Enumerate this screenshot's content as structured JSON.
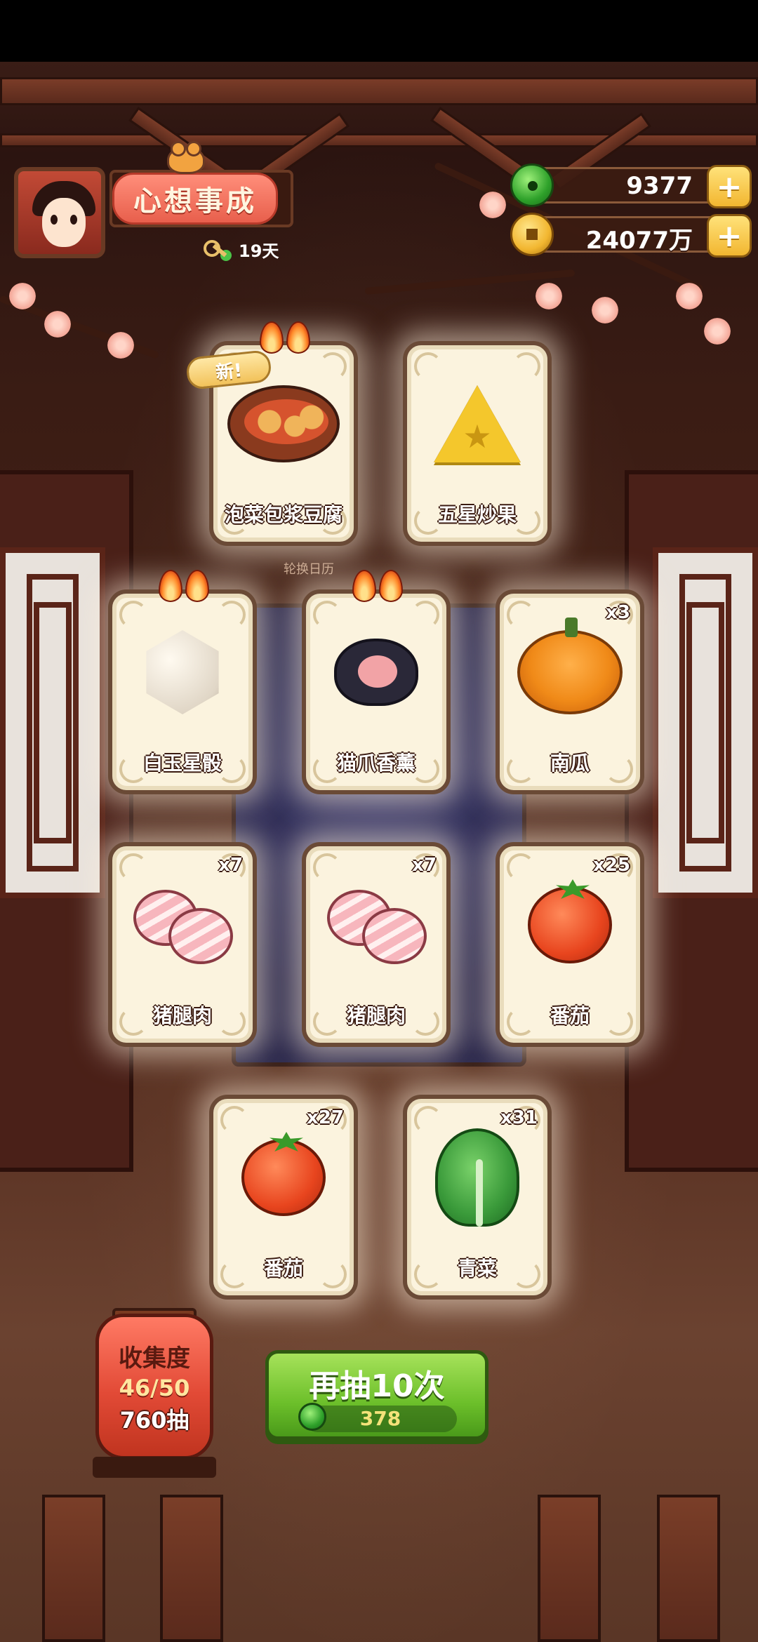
{
  "header": {
    "title_banner": "心想事成",
    "days_label": "19天"
  },
  "currencies": {
    "jade": {
      "value": "9377",
      "icon": "jade-icon"
    },
    "coins": {
      "value": "24077万",
      "icon": "coin-icon"
    },
    "plus_glyph": "+"
  },
  "new_badge": "新!",
  "calendar_caption": "轮换日历",
  "cards": [
    {
      "name": "泡菜包浆豆腐",
      "qty": "",
      "icon": "tofu-dish-icon",
      "flames": 2,
      "new": true
    },
    {
      "name": "五星炒果",
      "qty": "",
      "icon": "star-fruit-icon",
      "flames": 0,
      "new": false
    },
    {
      "name": "白玉星骰",
      "qty": "",
      "icon": "jade-dice-icon",
      "flames": 2,
      "new": false
    },
    {
      "name": "猫爪香薰",
      "qty": "",
      "icon": "cat-paw-candle-icon",
      "flames": 2,
      "new": false
    },
    {
      "name": "南瓜",
      "qty": "x3",
      "icon": "pumpkin-icon",
      "flames": 0,
      "new": false
    },
    {
      "name": "猪腿肉",
      "qty": "x7",
      "icon": "pork-leg-icon",
      "flames": 0,
      "new": false
    },
    {
      "name": "猪腿肉",
      "qty": "x7",
      "icon": "pork-leg-icon",
      "flames": 0,
      "new": false
    },
    {
      "name": "番茄",
      "qty": "x25",
      "icon": "tomato-icon",
      "flames": 0,
      "new": false
    },
    {
      "name": "番茄",
      "qty": "x27",
      "icon": "tomato-icon",
      "flames": 0,
      "new": false
    },
    {
      "name": "青菜",
      "qty": "x31",
      "icon": "greens-icon",
      "flames": 0,
      "new": false
    }
  ],
  "collection": {
    "label": "收集度",
    "progress": "46/50",
    "draws": "760抽"
  },
  "draw_button": {
    "label": "再抽10次",
    "cost": "378",
    "cost_icon": "jade-icon"
  }
}
